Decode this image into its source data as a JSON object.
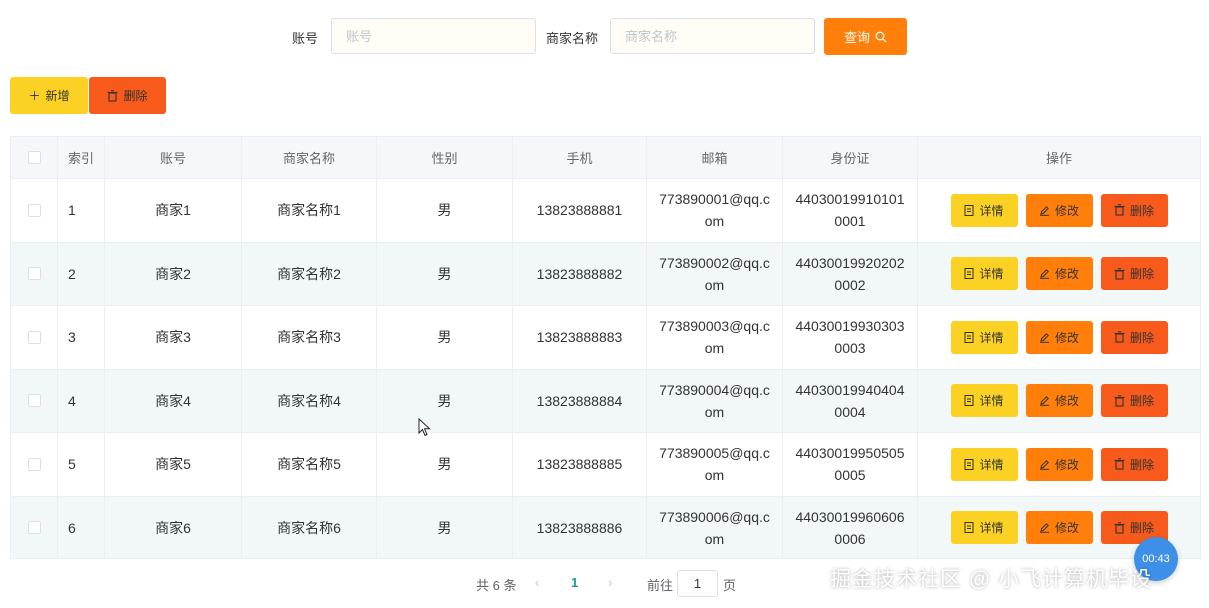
{
  "search": {
    "account_label": "账号",
    "account_placeholder": "账号",
    "account_value": "",
    "merchant_label": "商家名称",
    "merchant_placeholder": "商家名称",
    "merchant_value": "",
    "search_button": "查询",
    "search_icon": "search-icon"
  },
  "toolbar": {
    "add_button": "新增",
    "add_icon": "plus-icon",
    "delete_button": "删除",
    "delete_icon": "trash-icon"
  },
  "table": {
    "columns": [
      "",
      "索引",
      "账号",
      "商家名称",
      "性别",
      "手机",
      "邮箱",
      "身份证",
      "操作"
    ],
    "rows": [
      {
        "index": "1",
        "account": "商家1",
        "name": "商家名称1",
        "gender": "男",
        "phone": "13823888881",
        "email": "773890001@qq.com",
        "id_card": "440300199101010001"
      },
      {
        "index": "2",
        "account": "商家2",
        "name": "商家名称2",
        "gender": "男",
        "phone": "13823888882",
        "email": "773890002@qq.com",
        "id_card": "440300199202020002"
      },
      {
        "index": "3",
        "account": "商家3",
        "name": "商家名称3",
        "gender": "男",
        "phone": "13823888883",
        "email": "773890003@qq.com",
        "id_card": "440300199303030003"
      },
      {
        "index": "4",
        "account": "商家4",
        "name": "商家名称4",
        "gender": "男",
        "phone": "13823888884",
        "email": "773890004@qq.com",
        "id_card": "440300199404040004"
      },
      {
        "index": "5",
        "account": "商家5",
        "name": "商家名称5",
        "gender": "男",
        "phone": "13823888885",
        "email": "773890005@qq.com",
        "id_card": "440300199505050005"
      },
      {
        "index": "6",
        "account": "商家6",
        "name": "商家名称6",
        "gender": "男",
        "phone": "13823888886",
        "email": "773890006@qq.com",
        "id_card": "440300199606060006"
      }
    ],
    "actions": {
      "detail": "详情",
      "edit": "修改",
      "delete": "删除"
    }
  },
  "pagination": {
    "total": "共 6 条",
    "prev": "‹",
    "current_page": "1",
    "next": "›",
    "goto_label": "前往",
    "goto_value": "1",
    "page_suffix": "页"
  },
  "overlay": {
    "timer": "00:43",
    "watermark": "掘金技术社区 @ 小飞计算机毕设"
  },
  "colors": {
    "search_button": "#ff7f0a",
    "add_button": "#fbd224",
    "delete_button": "#f75a1b",
    "edit_button": "#ff7f0a",
    "row_alt": "#f2f8f8",
    "header_bg": "#f5f7fa",
    "current_page": "#1a9e8c"
  }
}
